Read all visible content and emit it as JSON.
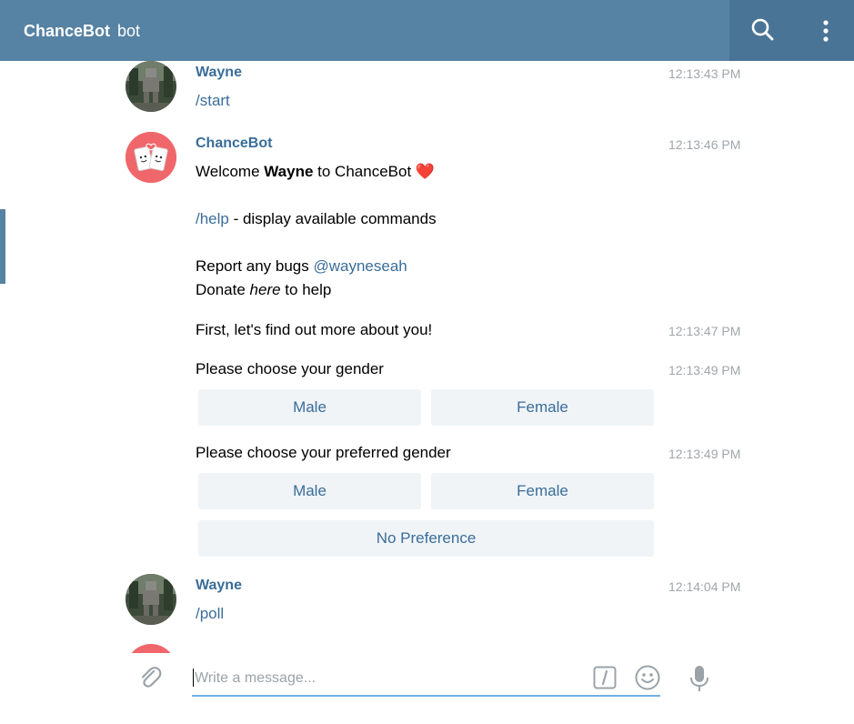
{
  "header": {
    "title": "ChanceBot",
    "subtitle": "bot",
    "search_icon": "search-icon",
    "more_icon": "more-vertical-icon"
  },
  "colors": {
    "header_bg": "#5682a3",
    "accent_link": "#3a6d99",
    "keyboard_button_bg": "#f0f4f7",
    "timestamp": "#a0a6ab",
    "input_underline": "#6fb0e2",
    "bot_avatar_bg": "#f0676b"
  },
  "messages": [
    {
      "author": "Wayne",
      "time": "12:13:43 PM",
      "text": "/start"
    },
    {
      "author": "ChanceBot",
      "time": "12:13:46 PM",
      "welcome": {
        "prefix": "Welcome ",
        "name": "Wayne",
        "suffix": " to ChanceBot",
        "emoji": "❤️"
      },
      "help_cmd": "/help",
      "help_text": " - display available commands",
      "bugs_prefix": "Report any bugs ",
      "bugs_handle": "@wayneseah",
      "donate_prefix": "Donate ",
      "donate_link": "here",
      "donate_suffix": " to help"
    },
    {
      "time": "12:13:47 PM",
      "text": "First, let's find out more about you!"
    },
    {
      "time": "12:13:49 PM",
      "text": "Please choose your gender",
      "buttons": [
        "Male",
        "Female"
      ]
    },
    {
      "time": "12:13:49 PM",
      "text": "Please choose your preferred gender",
      "buttons": [
        "Male",
        "Female"
      ],
      "button_wide": "No Preference"
    },
    {
      "author": "Wayne",
      "time": "12:14:04 PM",
      "text": "/poll"
    }
  ],
  "composer": {
    "placeholder": "Write a message...",
    "attach_icon": "paperclip-icon",
    "commands_icon": "slash-commands-icon",
    "emoji_icon": "emoji-smile-icon",
    "mic_icon": "microphone-icon"
  }
}
